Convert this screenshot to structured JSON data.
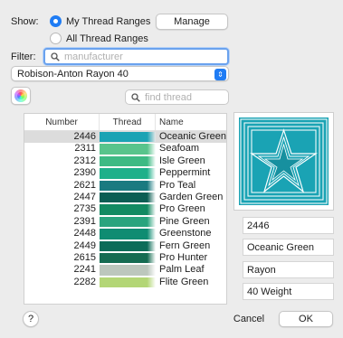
{
  "show": {
    "label": "Show:",
    "option1": "My Thread Ranges",
    "option2": "All Thread Ranges",
    "manage": "Manage"
  },
  "filter": {
    "label": "Filter:",
    "placeholder": "manufacturer",
    "selected_range": "Robison-Anton Rayon 40"
  },
  "find": {
    "placeholder": "find thread"
  },
  "table": {
    "headers": [
      "Number",
      "Thread",
      "Name"
    ],
    "rows": [
      {
        "number": "2446",
        "color": "#1aa3b4",
        "name": "Oceanic Green"
      },
      {
        "number": "2311",
        "color": "#58c48c",
        "name": "Seafoam"
      },
      {
        "number": "2312",
        "color": "#3dba84",
        "name": "Isle Green"
      },
      {
        "number": "2390",
        "color": "#1fb08a",
        "name": "Peppermint"
      },
      {
        "number": "2621",
        "color": "#1a7a80",
        "name": "Pro Teal"
      },
      {
        "number": "2447",
        "color": "#0b5e54",
        "name": "Garden Green"
      },
      {
        "number": "2735",
        "color": "#128a62",
        "name": "Pro Green"
      },
      {
        "number": "2391",
        "color": "#2aa47e",
        "name": "Pine Green"
      },
      {
        "number": "2448",
        "color": "#0f8c72",
        "name": "Greenstone"
      },
      {
        "number": "2449",
        "color": "#0c6c58",
        "name": "Fern Green"
      },
      {
        "number": "2615",
        "color": "#156c52",
        "name": "Pro Hunter"
      },
      {
        "number": "2241",
        "color": "#bcc7bd",
        "name": "Palm Leaf"
      },
      {
        "number": "2282",
        "color": "#b3d676",
        "name": "Flite Green"
      }
    ]
  },
  "details": {
    "number": "2446",
    "name": "Oceanic Green",
    "type": "Rayon",
    "weight": "40 Weight",
    "preview_color": "#1aa3b4"
  },
  "footer": {
    "help": "?",
    "cancel": "Cancel",
    "ok": "OK"
  }
}
